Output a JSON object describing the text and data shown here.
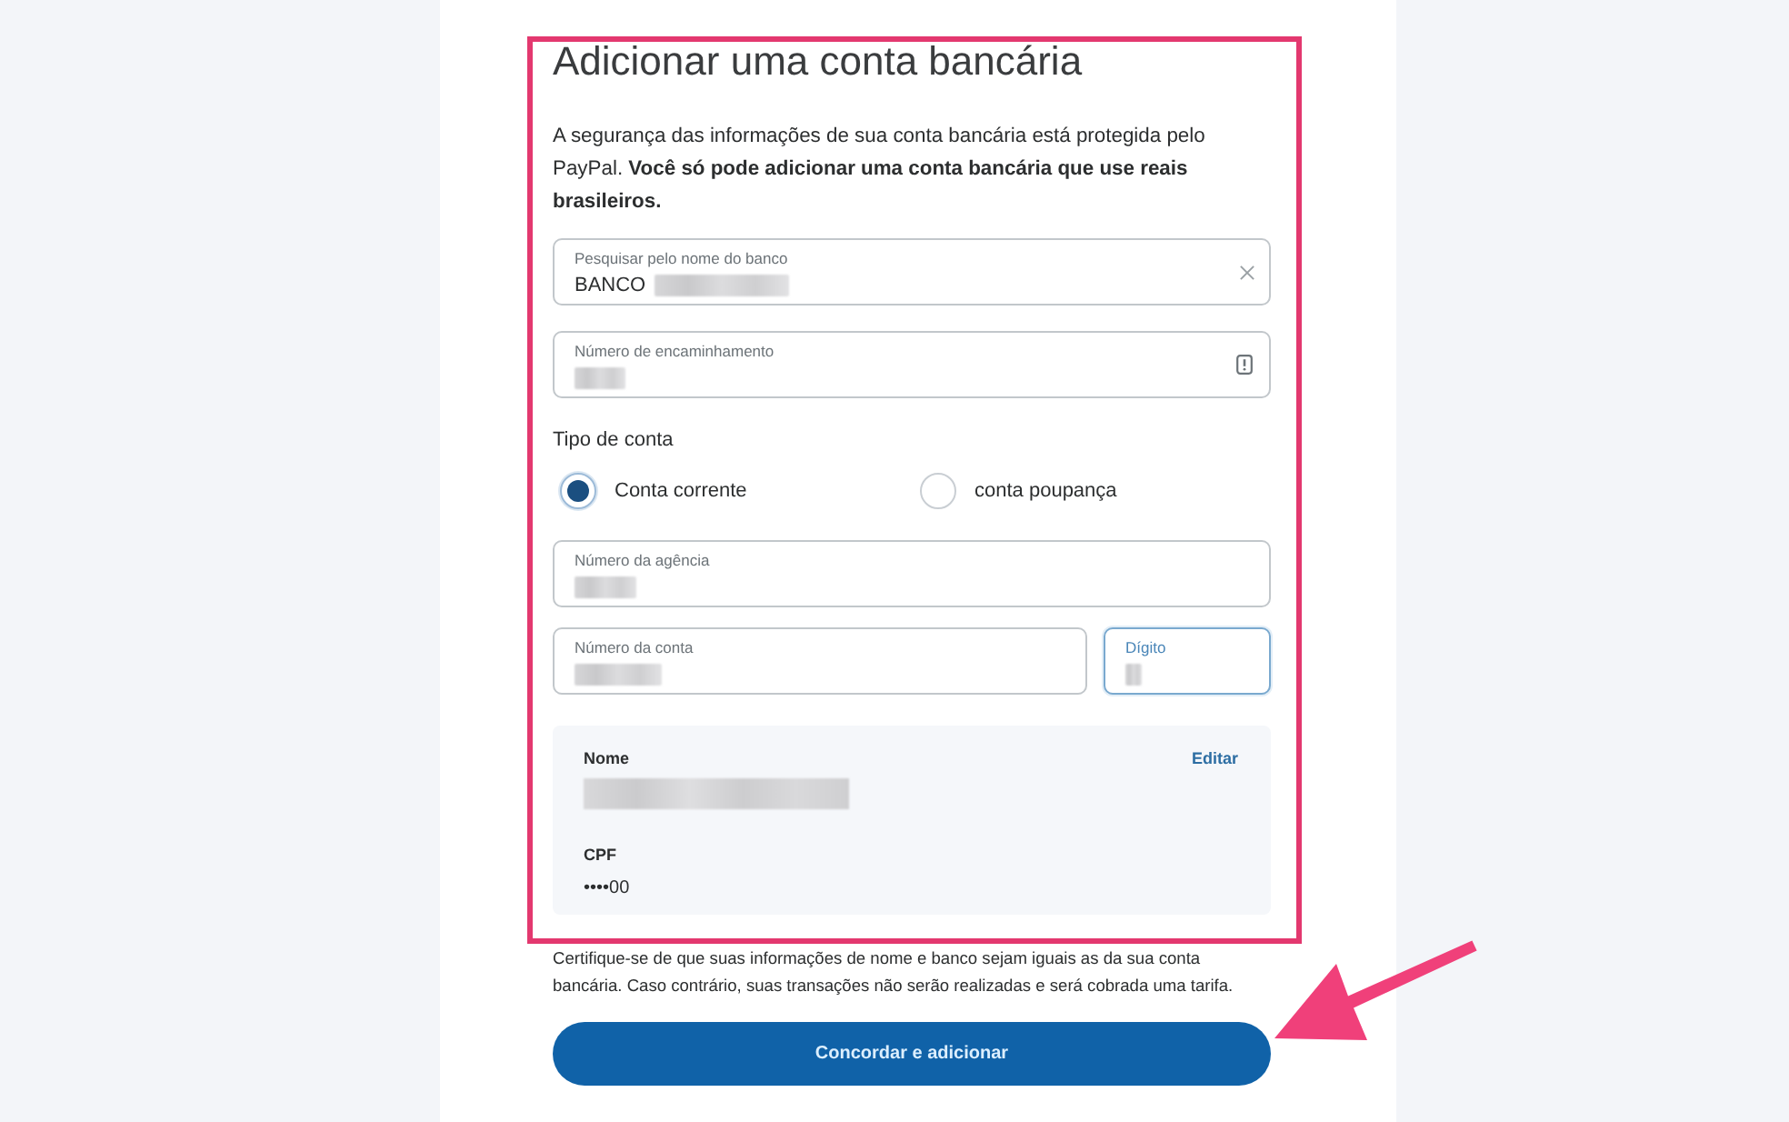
{
  "form": {
    "title": "Adicionar uma conta bancária",
    "intro": "A segurança das informações de sua conta bancária está protegida pelo PayPal. **Você só pode adicionar uma conta bancária que use reais brasileiros.**",
    "bank_fields": [
      {
        "kind": "clearable",
        "label": "Pesquisar pelo nome do banco",
        "value": "BANCO",
        "redacted": true,
        "focused": false
      },
      {
        "kind": "info",
        "label": "Número de encaminhamento",
        "redacted": true,
        "focused": false
      }
    ],
    "account_type": {
      "label": "Tipo de conta",
      "options": [
        {
          "label": "Conta corrente",
          "selected": true
        },
        {
          "label": "conta poupança",
          "selected": false
        }
      ]
    },
    "branch_field": {
      "label": "Número da agência",
      "redacted": true,
      "focused": false
    },
    "account_fields": [
      {
        "label": "Número da conta",
        "redacted": true,
        "focused": false
      },
      {
        "label": "Dígito",
        "redacted": true,
        "focused": true
      }
    ],
    "holder": {
      "name_label": "Nome",
      "edit_link": "Editar",
      "name_redacted": true,
      "cpf_label": "CPF",
      "cpf_value": "••••00"
    }
  },
  "notice": "Certifique-se de que suas informações de nome e banco sejam iguais as da sua conta bancária. Caso contrário, suas transações não serão realizadas e será cobrada uma tarifa.",
  "submit_button": "Concordar e adicionar",
  "annotations": {
    "highlight_frame": true,
    "pointer_arrow": true
  }
}
